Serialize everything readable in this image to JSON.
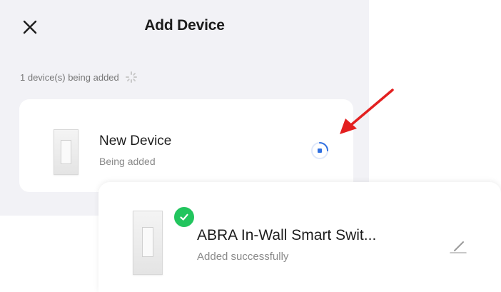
{
  "header": {
    "title": "Add Device",
    "close_icon": "close-icon"
  },
  "status": {
    "text": "1 device(s) being added",
    "icon": "loading-spinner-icon"
  },
  "pending_device": {
    "name": "New Device",
    "status": "Being added",
    "icon": "progress-spinner-icon"
  },
  "added_device": {
    "name": "ABRA In-Wall Smart Swit...",
    "status": "Added successfully",
    "badge_icon": "check-icon",
    "edit_icon": "pencil-icon"
  },
  "colors": {
    "accent_blue": "#2f6fe0",
    "success_green": "#22c55e",
    "annotation_red": "#e32020",
    "background_gray": "#f2f2f6"
  }
}
